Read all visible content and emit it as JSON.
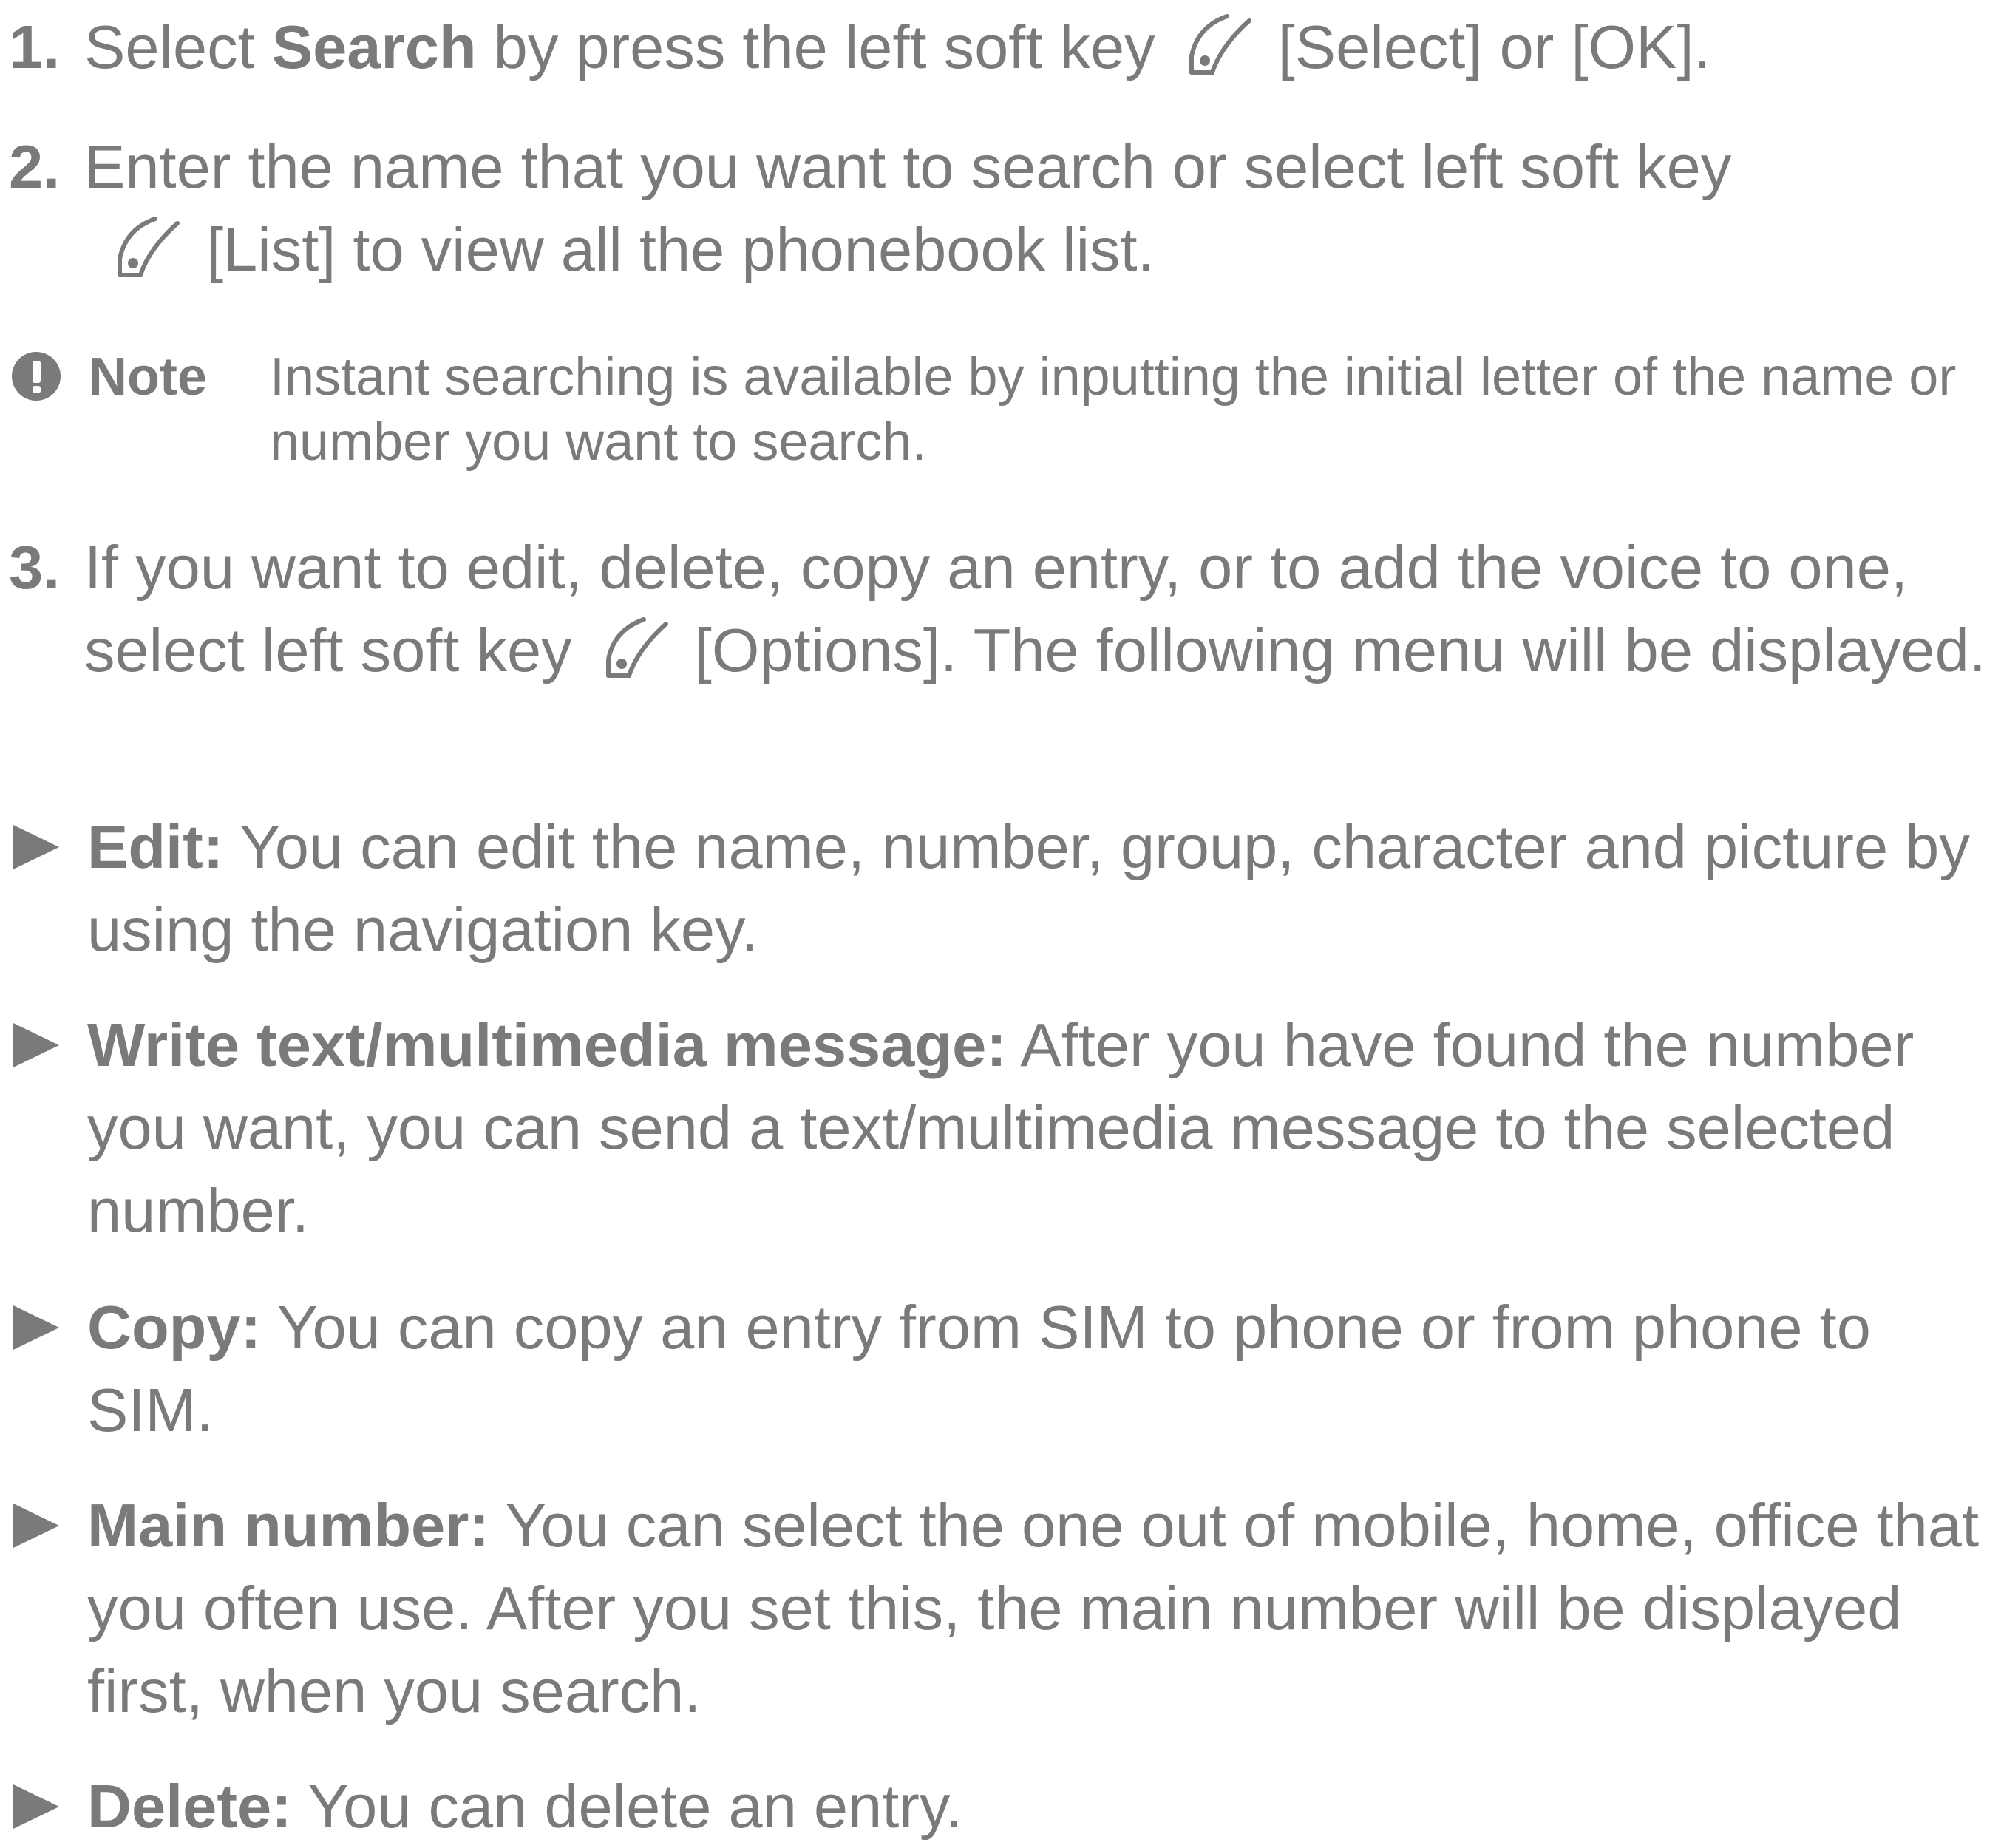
{
  "steps": [
    {
      "number": "1.",
      "before": "Select ",
      "bold": "Search",
      "after_bold": " by press the left soft key ",
      "key_label": "[Select] or [OK]."
    },
    {
      "number": "2.",
      "line1": "Enter the name that you want to search or select left soft key",
      "key_label": "[List] to view all the phonebook list."
    },
    {
      "number": "3.",
      "before": "If you want to edit, delete, copy an entry, or to add the voice to one, select left soft key ",
      "key_label": "[Options]. The following menu will be displayed."
    }
  ],
  "note": {
    "icon": "exclamation-circle-icon",
    "label": "Note",
    "text": "Instant searching is available by inputting the initial letter of the name or number you want to search."
  },
  "bullets": [
    {
      "term": "Edit:",
      "text": " You can edit the name, number, group, character and picture by using the navigation key."
    },
    {
      "term": "Write text/multimedia message:",
      "text": " After you have found the number you want, you can send a text/multimedia message to the selected number."
    },
    {
      "term": "Copy:",
      "text": " You can copy an entry from SIM to phone or from phone to SIM."
    },
    {
      "term": "Main number:",
      "text": " You can select the one out of mobile, home, office that you often use. After you set this, the main number will be displayed first, when you search."
    },
    {
      "term": "Delete:",
      "text": " You can delete an entry."
    }
  ],
  "icons": {
    "soft_key": "left-soft-key-icon",
    "bullet": "triangle-bullet-icon"
  },
  "colors": {
    "text": "#7a7a7a",
    "background": "#ffffff"
  }
}
